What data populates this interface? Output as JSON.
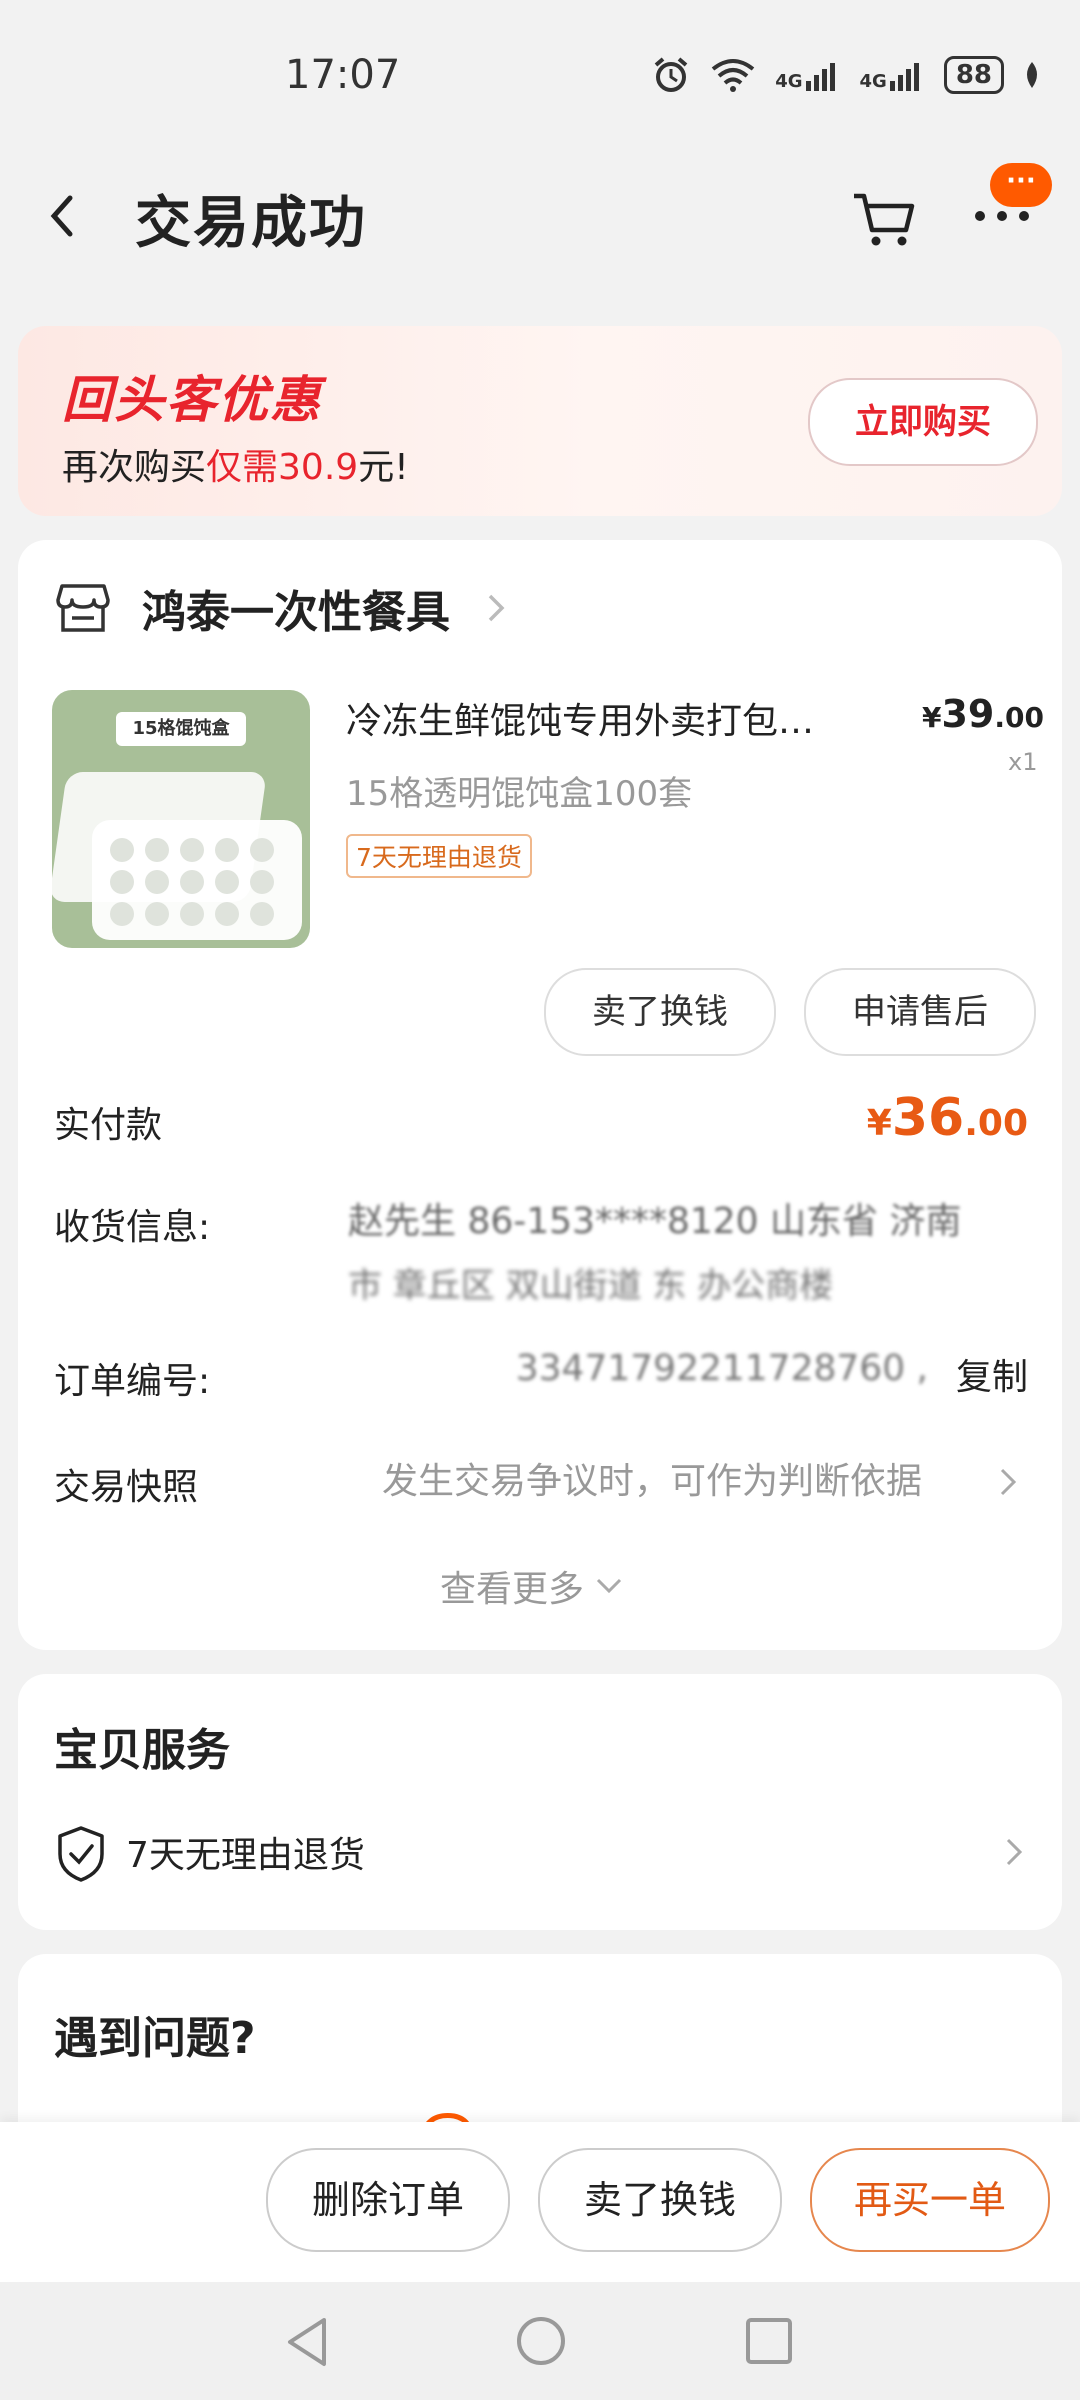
{
  "status_bar": {
    "time": "17:07",
    "network_1": "4G",
    "network_2": "4G",
    "battery": "88"
  },
  "header": {
    "title": "交易成功",
    "more_badge": "···"
  },
  "promo": {
    "title": "回头客优惠",
    "subtitle_prefix": "再次购买",
    "subtitle_highlight": "仅需30.9",
    "subtitle_suffix": "元!",
    "button": "立即购买"
  },
  "order": {
    "shop_name": "鸿泰一次性餐具",
    "product": {
      "image_label": "15格馄饨盒",
      "title": "冷冻生鲜馄饨专用外卖打包…",
      "spec": "15格透明馄饨盒100套",
      "tag": "7天无理由退货",
      "price_symbol": "¥",
      "price_int": "39",
      "price_dec": ".00",
      "qty": "x1"
    },
    "sell_button": "卖了换钱",
    "after_sale_button": "申请售后",
    "paid_label": "实付款",
    "paid_symbol": "¥",
    "paid_int": "36",
    "paid_dec": ".00",
    "address_label": "收货信息:",
    "address_line1": "赵先生 86-153****8120 山东省 济南",
    "address_line2": "市 章丘区 双山街道 东 办公商楼",
    "order_no_label": "订单编号:",
    "order_no_value": "33471792211728760 ,",
    "copy_button": "复制",
    "snapshot_label": "交易快照",
    "snapshot_value": "发生交易争议时，可作为判断依据",
    "see_more": "查看更多"
  },
  "service": {
    "title": "宝贝服务",
    "item": "7天无理由退货"
  },
  "problem": {
    "title": "遇到问题?"
  },
  "actions": {
    "delete": "删除订单",
    "sell": "卖了换钱",
    "rebuy": "再买一单"
  },
  "colors": {
    "accent_red": "#e8242d",
    "accent_orange": "#e85a14",
    "badge_orange": "#ff5a00"
  }
}
